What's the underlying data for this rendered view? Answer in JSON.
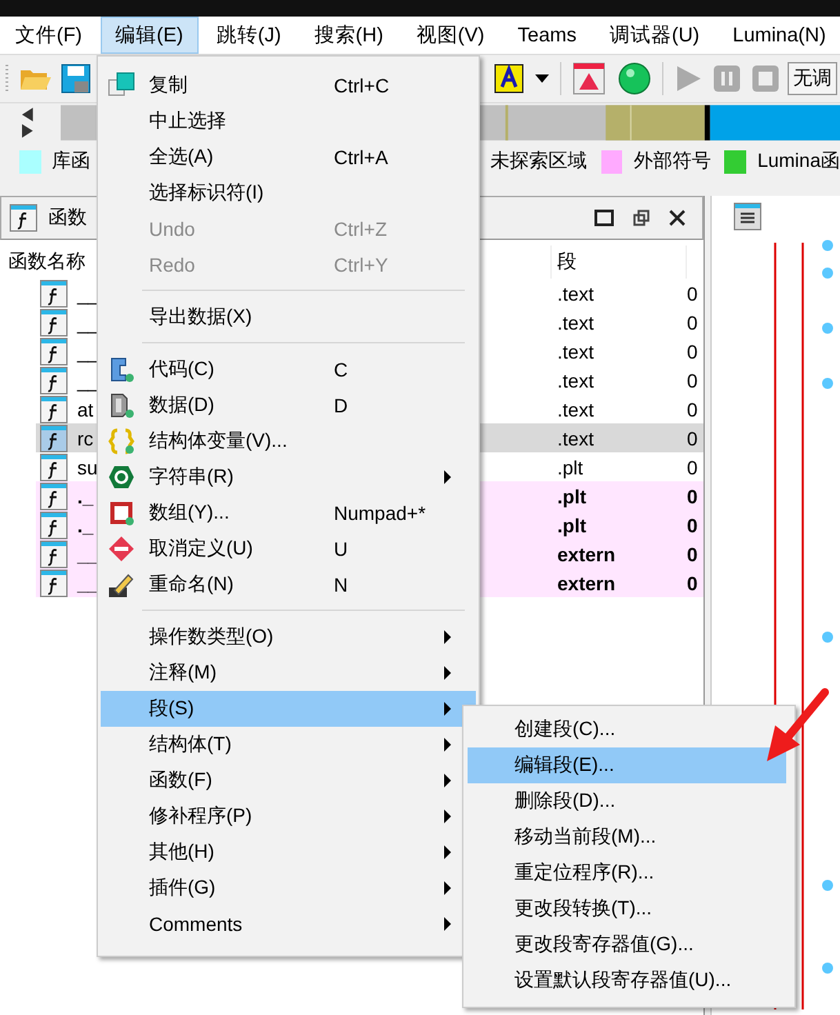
{
  "menubar": [
    {
      "label": "文件(F)",
      "selected": false
    },
    {
      "label": "编辑(E)",
      "selected": true
    },
    {
      "label": "跳转(J)",
      "selected": false
    },
    {
      "label": "搜索(H)",
      "selected": false
    },
    {
      "label": "视图(V)",
      "selected": false
    },
    {
      "label": "Teams",
      "selected": false
    },
    {
      "label": "调试器(U)",
      "selected": false
    },
    {
      "label": "Lumina(N)",
      "selected": false
    }
  ],
  "toolbar": {
    "debugger_select": "无调"
  },
  "legend": [
    {
      "label": "库函",
      "color": "#aaffff"
    },
    {
      "label": "未探索区域"
    },
    {
      "label": "外部符号",
      "color": "#ffaaff"
    },
    {
      "label": "Lumina函",
      "color": "#33cc33"
    }
  ],
  "functions_panel": {
    "title": "函数",
    "columns": [
      "函数名称",
      "段"
    ],
    "rows": [
      {
        "name": "__",
        "segment": ".text",
        "column_3": "0",
        "selected": false,
        "external": false
      },
      {
        "name": "__",
        "segment": ".text",
        "column_3": "0",
        "selected": false,
        "external": false
      },
      {
        "name": "__",
        "segment": ".text",
        "column_3": "0",
        "selected": false,
        "external": false
      },
      {
        "name": "__",
        "segment": ".text",
        "column_3": "0",
        "selected": false,
        "external": false
      },
      {
        "name": "at",
        "segment": ".text",
        "column_3": "0",
        "selected": false,
        "external": false
      },
      {
        "name": "rc",
        "segment": ".text",
        "column_3": "0",
        "selected": true,
        "external": false
      },
      {
        "name": "su",
        "segment": ".plt",
        "column_3": "0",
        "selected": false,
        "external": false
      },
      {
        "name": "._",
        "segment": ".plt",
        "column_3": "0",
        "selected": false,
        "external": true
      },
      {
        "name": "._",
        "segment": ".plt",
        "column_3": "0",
        "selected": false,
        "external": true
      },
      {
        "name": "__",
        "segment": "extern",
        "column_3": "0",
        "selected": false,
        "external": true
      },
      {
        "name": "__",
        "segment": "extern",
        "column_3": "0",
        "selected": false,
        "external": true
      }
    ]
  },
  "edit_menu": [
    {
      "kind": "item",
      "label": "复制",
      "shortcut": "Ctrl+C",
      "disabled": false,
      "submenu": false,
      "selected": false
    },
    {
      "kind": "item",
      "label": "中止选择",
      "disabled": false,
      "submenu": false,
      "selected": false
    },
    {
      "kind": "item",
      "label": "全选(A)",
      "shortcut": "Ctrl+A",
      "disabled": false,
      "submenu": false,
      "selected": false
    },
    {
      "kind": "item",
      "label": "选择标识符(I)",
      "disabled": false,
      "submenu": false,
      "selected": false
    },
    {
      "kind": "item",
      "label": "Undo",
      "shortcut": "Ctrl+Z",
      "disabled": true,
      "submenu": false,
      "selected": false
    },
    {
      "kind": "item",
      "label": "Redo",
      "shortcut": "Ctrl+Y",
      "disabled": true,
      "submenu": false,
      "selected": false
    },
    {
      "kind": "separator"
    },
    {
      "kind": "item",
      "label": "导出数据(X)",
      "disabled": false,
      "submenu": false,
      "selected": false
    },
    {
      "kind": "separator"
    },
    {
      "kind": "item",
      "label": "代码(C)",
      "shortcut": "C",
      "disabled": false,
      "submenu": false,
      "selected": false
    },
    {
      "kind": "item",
      "label": "数据(D)",
      "shortcut": "D",
      "disabled": false,
      "submenu": false,
      "selected": false
    },
    {
      "kind": "item",
      "label": "结构体变量(V)...",
      "disabled": false,
      "submenu": false,
      "selected": false
    },
    {
      "kind": "item",
      "label": "字符串(R)",
      "disabled": false,
      "submenu": true,
      "selected": false
    },
    {
      "kind": "item",
      "label": "数组(Y)...",
      "shortcut": "Numpad+*",
      "disabled": false,
      "submenu": false,
      "selected": false
    },
    {
      "kind": "item",
      "label": "取消定义(U)",
      "shortcut": "U",
      "disabled": false,
      "submenu": false,
      "selected": false
    },
    {
      "kind": "item",
      "label": "重命名(N)",
      "shortcut": "N",
      "disabled": false,
      "submenu": false,
      "selected": false
    },
    {
      "kind": "separator"
    },
    {
      "kind": "item",
      "label": "操作数类型(O)",
      "disabled": false,
      "submenu": true,
      "selected": false
    },
    {
      "kind": "item",
      "label": "注释(M)",
      "disabled": false,
      "submenu": true,
      "selected": false
    },
    {
      "kind": "item",
      "label": "段(S)",
      "disabled": false,
      "submenu": true,
      "selected": true
    },
    {
      "kind": "item",
      "label": "结构体(T)",
      "disabled": false,
      "submenu": true,
      "selected": false
    },
    {
      "kind": "item",
      "label": "函数(F)",
      "disabled": false,
      "submenu": true,
      "selected": false
    },
    {
      "kind": "item",
      "label": "修补程序(P)",
      "disabled": false,
      "submenu": true,
      "selected": false
    },
    {
      "kind": "item",
      "label": "其他(H)",
      "disabled": false,
      "submenu": true,
      "selected": false
    },
    {
      "kind": "item",
      "label": "插件(G)",
      "disabled": false,
      "submenu": true,
      "selected": false
    },
    {
      "kind": "item",
      "label": "Comments",
      "disabled": false,
      "submenu": true,
      "selected": false
    }
  ],
  "segment_submenu": [
    {
      "label": "创建段(C)...",
      "selected": false
    },
    {
      "label": "编辑段(E)...",
      "selected": true
    },
    {
      "label": "删除段(D)...",
      "selected": false
    },
    {
      "label": "移动当前段(M)...",
      "selected": false
    },
    {
      "label": "重定位程序(R)...",
      "selected": false
    },
    {
      "label": "更改段转换(T)...",
      "selected": false
    },
    {
      "label": "更改段寄存器值(G)...",
      "selected": false
    },
    {
      "label": "设置默认段寄存器值(U)...",
      "selected": false
    }
  ]
}
